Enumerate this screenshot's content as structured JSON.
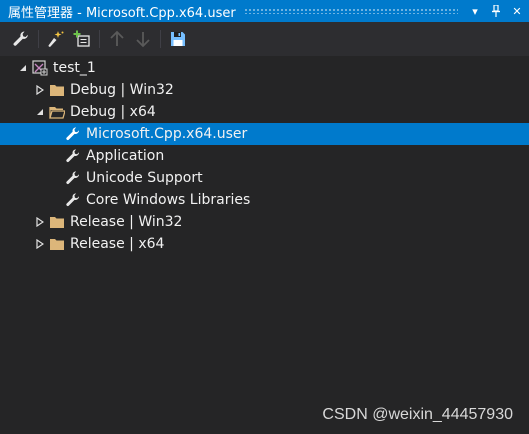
{
  "window": {
    "title": "属性管理器 - Microsoft.Cpp.x64.user",
    "dropdown_glyph": "▾",
    "pin_glyph": "⊥",
    "close_glyph": "✕"
  },
  "toolbar": {
    "buttons": [
      {
        "name": "properties-button",
        "icon": "wrench-icon",
        "enabled": true
      },
      {
        "name": "add-new-property-sheet-button",
        "icon": "new-sheet-icon",
        "enabled": true
      },
      {
        "name": "add-existing-property-sheet-button",
        "icon": "add-existing-icon",
        "enabled": true
      },
      {
        "name": "move-up-button",
        "icon": "arrow-up-icon",
        "enabled": false
      },
      {
        "name": "move-down-button",
        "icon": "arrow-down-icon",
        "enabled": false
      },
      {
        "name": "save-button",
        "icon": "save-icon",
        "enabled": true
      }
    ]
  },
  "tree": {
    "project": "test_1",
    "configs": [
      {
        "label": "Debug | Win32",
        "expanded": false
      },
      {
        "label": "Debug | x64",
        "expanded": true
      },
      {
        "label": "Release | Win32",
        "expanded": false
      },
      {
        "label": "Release | x64",
        "expanded": false
      }
    ],
    "sheets": [
      {
        "label": "Microsoft.Cpp.x64.user",
        "selected": true
      },
      {
        "label": "Application",
        "selected": false
      },
      {
        "label": "Unicode Support",
        "selected": false
      },
      {
        "label": "Core Windows Libraries",
        "selected": false
      }
    ]
  },
  "watermark": "CSDN @weixin_44457930",
  "colors": {
    "accent": "#007acc",
    "background": "#252526",
    "toolbar": "#2d2d30",
    "text": "#f1f1f1",
    "folder": "#dcb67a",
    "disabled": "#5a5a5a"
  }
}
